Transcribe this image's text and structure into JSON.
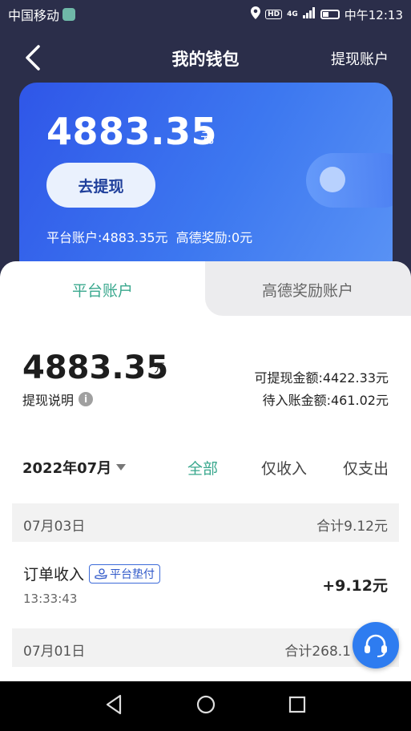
{
  "statusbar": {
    "carrier": "中国移动",
    "hd": "HD",
    "network": "4G",
    "time": "中午12:13"
  },
  "nav": {
    "title": "我的钱包",
    "action": "提现账户"
  },
  "card": {
    "amount": "4883.35",
    "unit": "元",
    "withdraw_label": "去提现",
    "platform_balance": "平台账户:4883.35元",
    "reward_balance": "高德奖励:0元"
  },
  "tabs": {
    "active": "平台账户",
    "inactive": "高德奖励账户"
  },
  "account": {
    "amount": "4883.35",
    "unit": "元",
    "note": "提现说明",
    "withdrawable": "可提现金额:4422.33元",
    "pending": "待入账金额:461.02元"
  },
  "filter": {
    "month": "2022年07月",
    "all": "全部",
    "income": "仅收入",
    "expense": "仅支出"
  },
  "records": [
    {
      "date": "07月03日",
      "total": "合计9.12元"
    },
    {
      "date": "07月01日",
      "total": "合计268.1"
    }
  ],
  "order": {
    "name": "订单收入",
    "badge": "平台垫付",
    "time": "13:33:43",
    "amount": "+9.12元"
  },
  "colors": {
    "accent": "#3aa88e",
    "card_blue": "#3d78f0",
    "help_blue": "#2e7cf0"
  }
}
